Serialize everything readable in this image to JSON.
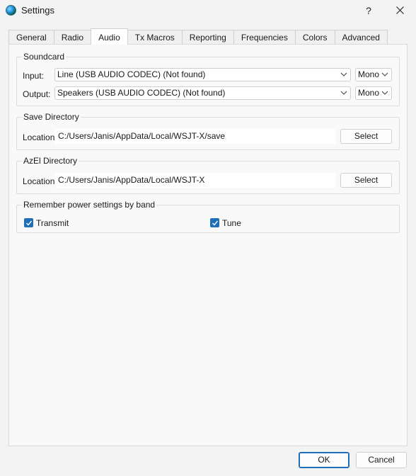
{
  "window": {
    "title": "Settings",
    "help_label": "?",
    "icon": "wsjt-globe-icon"
  },
  "tabs": [
    {
      "label": "General"
    },
    {
      "label": "Radio"
    },
    {
      "label": "Audio",
      "active": true
    },
    {
      "label": "Tx Macros"
    },
    {
      "label": "Reporting"
    },
    {
      "label": "Frequencies"
    },
    {
      "label": "Colors"
    },
    {
      "label": "Advanced"
    }
  ],
  "soundcard": {
    "title": "Soundcard",
    "input_label": "Input:",
    "input_value": "Line (USB AUDIO  CODEC) (Not found)",
    "input_channel": "Mono",
    "output_label": "Output:",
    "output_value": "Speakers (USB AUDIO  CODEC) (Not found)",
    "output_channel": "Mono"
  },
  "save_dir": {
    "title": "Save Directory",
    "location_label": "Location:",
    "path": "C:/Users/Janis/AppData/Local/WSJT-X/save",
    "button": "Select"
  },
  "azel_dir": {
    "title": "AzEl Directory",
    "location_label": "Location:",
    "path": "C:/Users/Janis/AppData/Local/WSJT-X",
    "button": "Select"
  },
  "power": {
    "title": "Remember power settings by band",
    "transmit_label": "Transmit",
    "transmit_checked": true,
    "tune_label": "Tune",
    "tune_checked": true
  },
  "footer": {
    "ok_label": "OK",
    "cancel_label": "Cancel"
  },
  "colors": {
    "accent": "#1f6fb8",
    "background": "#f3f3f3"
  }
}
